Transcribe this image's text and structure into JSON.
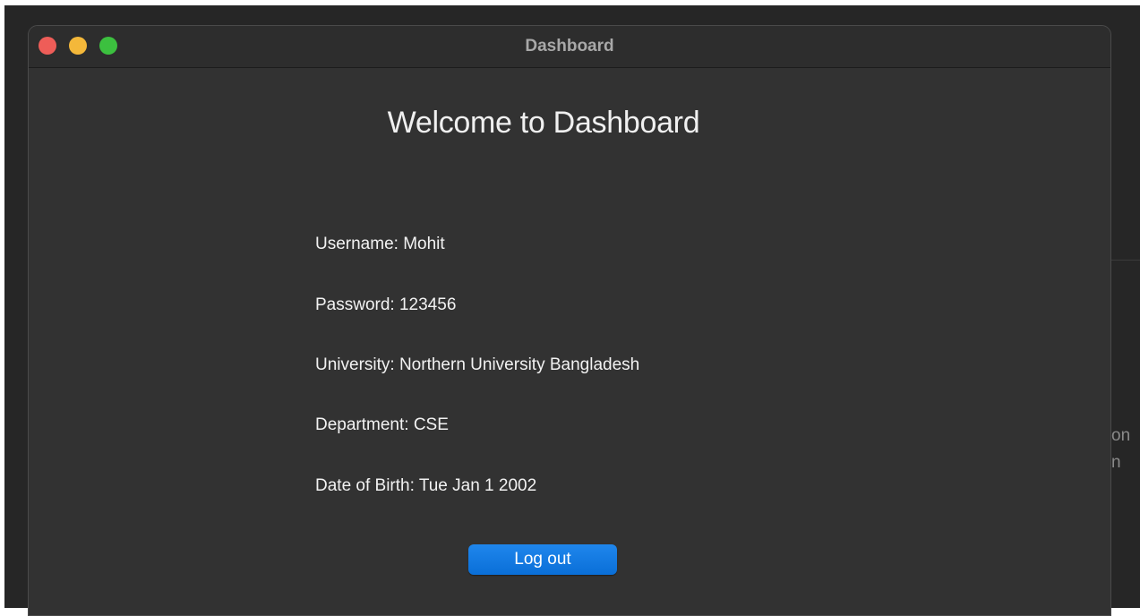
{
  "window": {
    "title": "Dashboard"
  },
  "background": {
    "text_line_1": "on",
    "text_line_2": "n"
  },
  "dashboard": {
    "heading": "Welcome to Dashboard",
    "fields": [
      {
        "text": "Username: Mohit"
      },
      {
        "text": "Password: 123456"
      },
      {
        "text": "University: Northern University Bangladesh"
      },
      {
        "text": "Department: CSE"
      },
      {
        "text": "Date of Birth: Tue Jan 1 2002"
      }
    ],
    "logout_label": "Log out"
  },
  "colors": {
    "close": "#ee5d58",
    "minimize": "#f4b83a",
    "zoom": "#3cc03f",
    "accent_button": "#0a6fd8",
    "window_background": "#323232"
  }
}
